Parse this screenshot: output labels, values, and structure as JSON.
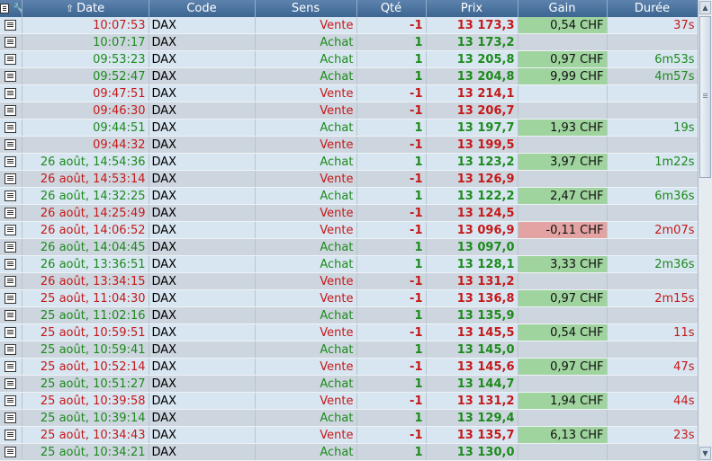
{
  "columns": {
    "date": "Date",
    "code": "Code",
    "sens": "Sens",
    "qty": "Qté",
    "price": "Prix",
    "gain": "Gain",
    "duration": "Durée"
  },
  "colors": {
    "sell": "#c41919",
    "buy": "#1d8a1d",
    "gain_positive": "#9fd49f",
    "gain_negative": "#e3a3a3",
    "header": "#4a729c"
  },
  "rows": [
    {
      "date": "10:07:53",
      "code": "DAX",
      "sens": "Vente",
      "qty": "-1",
      "price": "13 173,3",
      "gain": "0,54 CHF",
      "duration": "37s",
      "side": "sell",
      "gain_sign": "pos"
    },
    {
      "date": "10:07:17",
      "code": "DAX",
      "sens": "Achat",
      "qty": "1",
      "price": "13 173,2",
      "gain": "",
      "duration": "",
      "side": "buy",
      "gain_sign": ""
    },
    {
      "date": "09:53:23",
      "code": "DAX",
      "sens": "Achat",
      "qty": "1",
      "price": "13 205,8",
      "gain": "0,97 CHF",
      "duration": "6m53s",
      "side": "buy",
      "gain_sign": "pos"
    },
    {
      "date": "09:52:47",
      "code": "DAX",
      "sens": "Achat",
      "qty": "1",
      "price": "13 204,8",
      "gain": "9,99 CHF",
      "duration": "4m57s",
      "side": "buy",
      "gain_sign": "pos"
    },
    {
      "date": "09:47:51",
      "code": "DAX",
      "sens": "Vente",
      "qty": "-1",
      "price": "13 214,1",
      "gain": "",
      "duration": "",
      "side": "sell",
      "gain_sign": ""
    },
    {
      "date": "09:46:30",
      "code": "DAX",
      "sens": "Vente",
      "qty": "-1",
      "price": "13 206,7",
      "gain": "",
      "duration": "",
      "side": "sell",
      "gain_sign": ""
    },
    {
      "date": "09:44:51",
      "code": "DAX",
      "sens": "Achat",
      "qty": "1",
      "price": "13 197,7",
      "gain": "1,93 CHF",
      "duration": "19s",
      "side": "buy",
      "gain_sign": "pos"
    },
    {
      "date": "09:44:32",
      "code": "DAX",
      "sens": "Vente",
      "qty": "-1",
      "price": "13 199,5",
      "gain": "",
      "duration": "",
      "side": "sell",
      "gain_sign": ""
    },
    {
      "date": "26 août, 14:54:36",
      "code": "DAX",
      "sens": "Achat",
      "qty": "1",
      "price": "13 123,2",
      "gain": "3,97 CHF",
      "duration": "1m22s",
      "side": "buy",
      "gain_sign": "pos"
    },
    {
      "date": "26 août, 14:53:14",
      "code": "DAX",
      "sens": "Vente",
      "qty": "-1",
      "price": "13 126,9",
      "gain": "",
      "duration": "",
      "side": "sell",
      "gain_sign": ""
    },
    {
      "date": "26 août, 14:32:25",
      "code": "DAX",
      "sens": "Achat",
      "qty": "1",
      "price": "13 122,2",
      "gain": "2,47 CHF",
      "duration": "6m36s",
      "side": "buy",
      "gain_sign": "pos"
    },
    {
      "date": "26 août, 14:25:49",
      "code": "DAX",
      "sens": "Vente",
      "qty": "-1",
      "price": "13 124,5",
      "gain": "",
      "duration": "",
      "side": "sell",
      "gain_sign": ""
    },
    {
      "date": "26 août, 14:06:52",
      "code": "DAX",
      "sens": "Vente",
      "qty": "-1",
      "price": "13 096,9",
      "gain": "-0,11 CHF",
      "duration": "2m07s",
      "side": "sell",
      "gain_sign": "neg"
    },
    {
      "date": "26 août, 14:04:45",
      "code": "DAX",
      "sens": "Achat",
      "qty": "1",
      "price": "13 097,0",
      "gain": "",
      "duration": "",
      "side": "buy",
      "gain_sign": ""
    },
    {
      "date": "26 août, 13:36:51",
      "code": "DAX",
      "sens": "Achat",
      "qty": "1",
      "price": "13 128,1",
      "gain": "3,33 CHF",
      "duration": "2m36s",
      "side": "buy",
      "gain_sign": "pos"
    },
    {
      "date": "26 août, 13:34:15",
      "code": "DAX",
      "sens": "Vente",
      "qty": "-1",
      "price": "13 131,2",
      "gain": "",
      "duration": "",
      "side": "sell",
      "gain_sign": ""
    },
    {
      "date": "25 août, 11:04:30",
      "code": "DAX",
      "sens": "Vente",
      "qty": "-1",
      "price": "13 136,8",
      "gain": "0,97 CHF",
      "duration": "2m15s",
      "side": "sell",
      "gain_sign": "pos"
    },
    {
      "date": "25 août, 11:02:16",
      "code": "DAX",
      "sens": "Achat",
      "qty": "1",
      "price": "13 135,9",
      "gain": "",
      "duration": "",
      "side": "buy",
      "gain_sign": ""
    },
    {
      "date": "25 août, 10:59:51",
      "code": "DAX",
      "sens": "Vente",
      "qty": "-1",
      "price": "13 145,5",
      "gain": "0,54 CHF",
      "duration": "11s",
      "side": "sell",
      "gain_sign": "pos"
    },
    {
      "date": "25 août, 10:59:41",
      "code": "DAX",
      "sens": "Achat",
      "qty": "1",
      "price": "13 145,0",
      "gain": "",
      "duration": "",
      "side": "buy",
      "gain_sign": ""
    },
    {
      "date": "25 août, 10:52:14",
      "code": "DAX",
      "sens": "Vente",
      "qty": "-1",
      "price": "13 145,6",
      "gain": "0,97 CHF",
      "duration": "47s",
      "side": "sell",
      "gain_sign": "pos"
    },
    {
      "date": "25 août, 10:51:27",
      "code": "DAX",
      "sens": "Achat",
      "qty": "1",
      "price": "13 144,7",
      "gain": "",
      "duration": "",
      "side": "buy",
      "gain_sign": ""
    },
    {
      "date": "25 août, 10:39:58",
      "code": "DAX",
      "sens": "Vente",
      "qty": "-1",
      "price": "13 131,2",
      "gain": "1,94 CHF",
      "duration": "44s",
      "side": "sell",
      "gain_sign": "pos"
    },
    {
      "date": "25 août, 10:39:14",
      "code": "DAX",
      "sens": "Achat",
      "qty": "1",
      "price": "13 129,4",
      "gain": "",
      "duration": "",
      "side": "buy",
      "gain_sign": ""
    },
    {
      "date": "25 août, 10:34:43",
      "code": "DAX",
      "sens": "Vente",
      "qty": "-1",
      "price": "13 135,7",
      "gain": "6,13 CHF",
      "duration": "23s",
      "side": "sell",
      "gain_sign": "pos"
    },
    {
      "date": "25 août, 10:34:21",
      "code": "DAX",
      "sens": "Achat",
      "qty": "1",
      "price": "13 130,0",
      "gain": "",
      "duration": "",
      "side": "buy",
      "gain_sign": ""
    }
  ]
}
